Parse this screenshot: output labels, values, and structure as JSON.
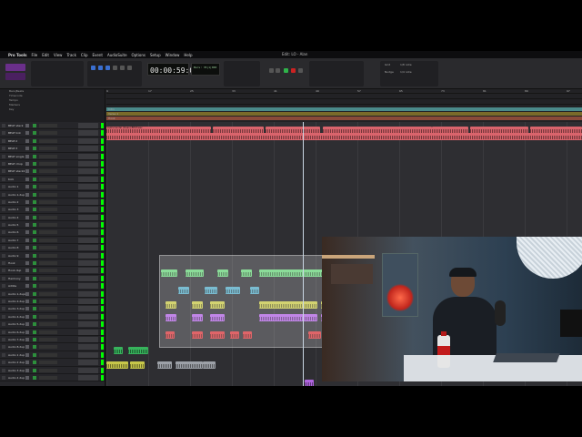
{
  "menubar": {
    "app_name": "Pro Tools",
    "items": [
      "File",
      "Edit",
      "View",
      "Track",
      "Clip",
      "Event",
      "AudioSuite",
      "Options",
      "Setup",
      "Window",
      "Help"
    ],
    "window_title": "Edit: LO - Alan"
  },
  "transport": {
    "main_counter": "00:00:59:08",
    "sub_counter": "Bars: 35|1|000",
    "grid_label": "Grid",
    "grid_value": "1/8 note",
    "nudge_label": "Nudge",
    "nudge_value": "1/4 note",
    "colors": {
      "zoom": "#6a2f8a",
      "play": "#2fb34a",
      "record": "#cc2222"
    }
  },
  "rulers": {
    "labels": [
      "Bars|Beats",
      "Timecode",
      "Tempo",
      "Markers",
      "Key"
    ],
    "bar_ticks": [
      "9",
      "17",
      "25",
      "33",
      "41",
      "49",
      "57",
      "65",
      "73",
      "81",
      "89",
      "97"
    ],
    "marker_rows": [
      "Intro",
      "Verse 1",
      "Hook"
    ]
  },
  "tracks": [
    {
      "name": "BEAT stack"
    },
    {
      "name": "BEAT link"
    },
    {
      "name": "BEAT.2"
    },
    {
      "name": "BEAT.3"
    },
    {
      "name": "BEAT single"
    },
    {
      "name": "BEAT chop"
    },
    {
      "name": "BEAT stack2"
    },
    {
      "name": "Kick"
    },
    {
      "name": "Audio 1"
    },
    {
      "name": "Audio 1.dup"
    },
    {
      "name": "Audio 2"
    },
    {
      "name": "Audio 3"
    },
    {
      "name": "Audio 4"
    },
    {
      "name": "Audio 5"
    },
    {
      "name": "Audio 6"
    },
    {
      "name": "Audio 7"
    },
    {
      "name": "Audio 8"
    },
    {
      "name": "Audio 9"
    },
    {
      "name": "Hook"
    },
    {
      "name": "Hook.dup"
    },
    {
      "name": "Harmony"
    },
    {
      "name": "Adlibs"
    },
    {
      "name": "Audio 1.dup2"
    },
    {
      "name": "Audio 2.dup"
    },
    {
      "name": "Audio 3.dup"
    },
    {
      "name": "Audio 4.dup"
    },
    {
      "name": "Audio 5.dup"
    },
    {
      "name": "Audio 6.dup"
    },
    {
      "name": "Audio 7.dup"
    },
    {
      "name": "Audio 8.dup"
    },
    {
      "name": "Audio 1 dup"
    },
    {
      "name": "Audio 2 dup"
    },
    {
      "name": "Audio 3 dup"
    },
    {
      "name": "Audio 4 dup"
    }
  ],
  "clips": {
    "beat_label": "Instrumental (Clean) BEAT.wav"
  }
}
